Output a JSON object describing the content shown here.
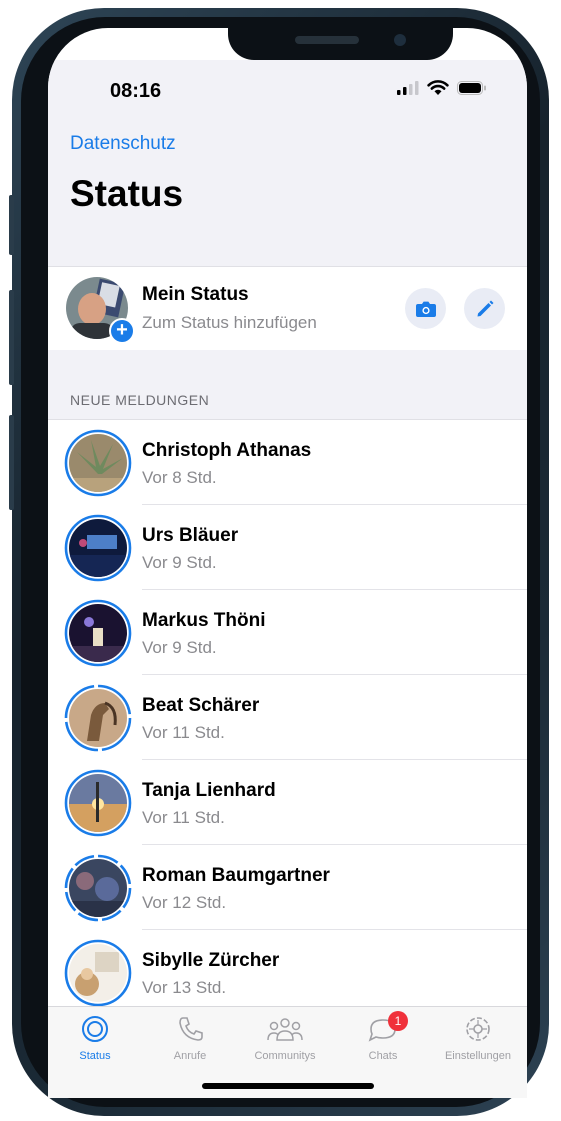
{
  "status_bar": {
    "time": "08:16"
  },
  "header": {
    "privacy_link": "Datenschutz",
    "title": "Status"
  },
  "my_status": {
    "name": "Mein Status",
    "subtitle": "Zum Status hinzufügen"
  },
  "section_label": "NEUE MELDUNGEN",
  "updates": [
    {
      "name": "Christoph Athanas",
      "time": "Vor 8 Std.",
      "viewed": false
    },
    {
      "name": "Urs Bläuer",
      "time": "Vor 9 Std.",
      "viewed": false
    },
    {
      "name": "Markus Thöni",
      "time": "Vor 9 Std.",
      "viewed": false
    },
    {
      "name": "Beat Schärer",
      "time": "Vor 11 Std.",
      "viewed": false
    },
    {
      "name": "Tanja Lienhard",
      "time": "Vor 11 Std.",
      "viewed": false
    },
    {
      "name": "Roman Baumgartner",
      "time": "Vor 12 Std.",
      "viewed": false
    },
    {
      "name": "Sibylle Zürcher",
      "time": "Vor 13 Std.",
      "viewed": false
    }
  ],
  "tabs": [
    {
      "label": "Status",
      "icon": "status-icon",
      "active": true
    },
    {
      "label": "Anrufe",
      "icon": "phone-icon",
      "active": false
    },
    {
      "label": "Communitys",
      "icon": "communities-icon",
      "active": false
    },
    {
      "label": "Chats",
      "icon": "chats-icon",
      "active": false,
      "badge": "1"
    },
    {
      "label": "Einstellungen",
      "icon": "gear-icon",
      "active": false
    }
  ],
  "colors": {
    "accent": "#1a7ce8",
    "badge": "#f0313b"
  }
}
